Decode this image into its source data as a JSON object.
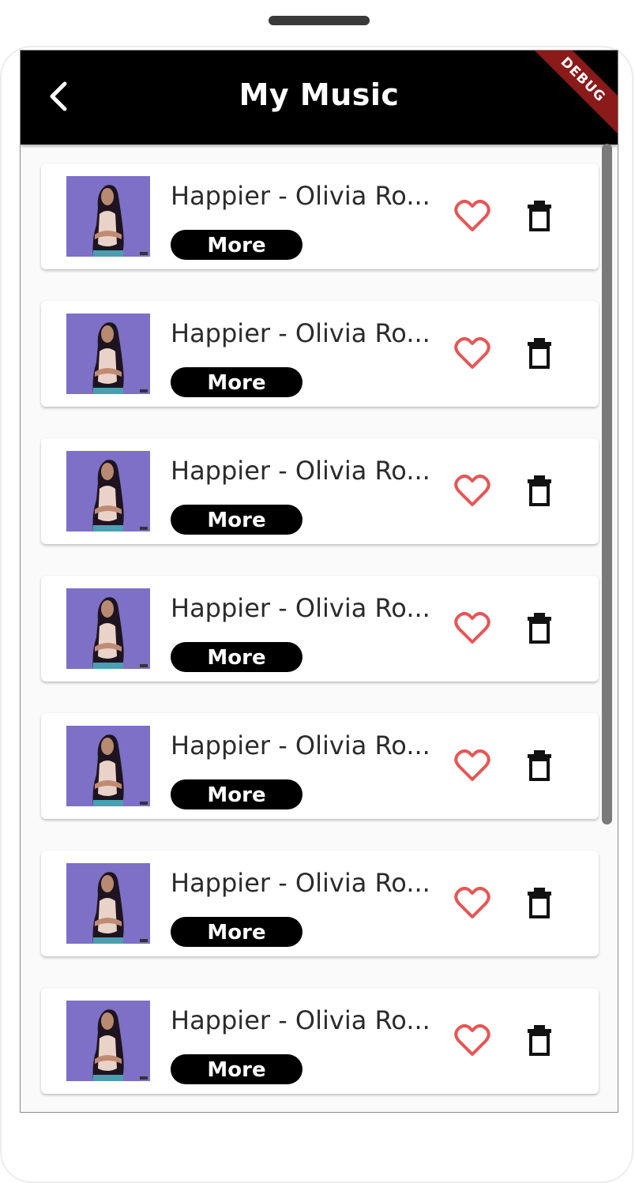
{
  "appbar": {
    "title": "My Music",
    "back_icon": "arrow-back-icon",
    "debug_label": "DEBUG"
  },
  "colors": {
    "appbar_bg": "#000000",
    "heart": "#e85555",
    "thumb_bg": "#7d70c6",
    "debug_banner": "#8b1a1a"
  },
  "songs": [
    {
      "title": "Happier - Olivia Ro...",
      "more_label": "More"
    },
    {
      "title": "Happier - Olivia Ro...",
      "more_label": "More"
    },
    {
      "title": "Happier - Olivia Ro...",
      "more_label": "More"
    },
    {
      "title": "Happier - Olivia Ro...",
      "more_label": "More"
    },
    {
      "title": "Happier - Olivia Ro...",
      "more_label": "More"
    },
    {
      "title": "Happier - Olivia Ro...",
      "more_label": "More"
    },
    {
      "title": "Happier - Olivia Ro...",
      "more_label": "More"
    }
  ]
}
